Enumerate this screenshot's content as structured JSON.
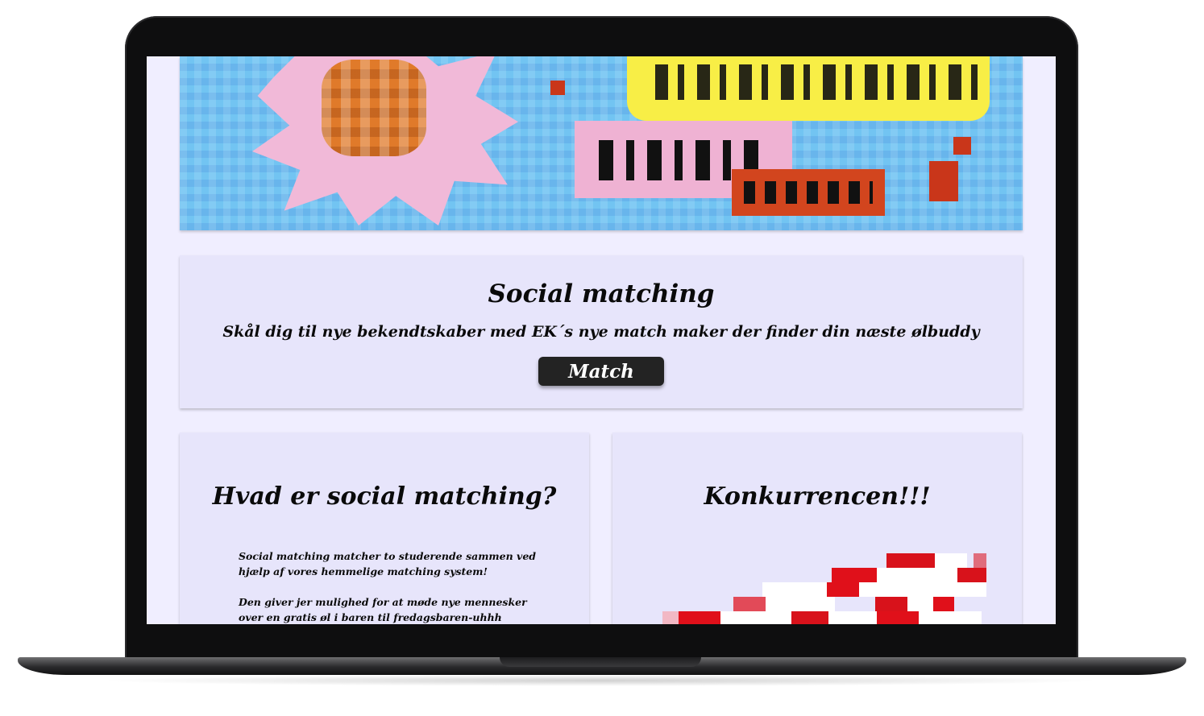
{
  "banner": {
    "alt": "Pixelated event banner artwork",
    "colors": {
      "background": "#72c4f2",
      "pink": "#f1b9d8",
      "yellow": "#f8ee46",
      "red": "#d2451e",
      "orange": "#e07a2a"
    }
  },
  "hero": {
    "title": "Social matching",
    "subtitle": "Skål dig til nye bekendtskaber med EK´s nye match maker der finder din næste ølbuddy",
    "button_label": "Match"
  },
  "left_card": {
    "title": "Hvad er social matching?",
    "paragraph_1_line_1": "Social matching matcher to studerende sammen ved",
    "paragraph_1_line_2": "hjælp af vores hemmelige matching system!",
    "paragraph_2_line_1": "Den giver jer mulighed for at møde nye mennesker",
    "paragraph_2_line_2": "over en gratis øl i baren til fredagsbaren-uhhh"
  },
  "right_card": {
    "title": "Konkurrencen!!!",
    "image_alt": "Pixelated red and white image"
  },
  "theme": {
    "page_background": "#f0eeff",
    "card_background": "#e7e5fb",
    "button_background": "#232323",
    "button_text": "#ffffff"
  }
}
